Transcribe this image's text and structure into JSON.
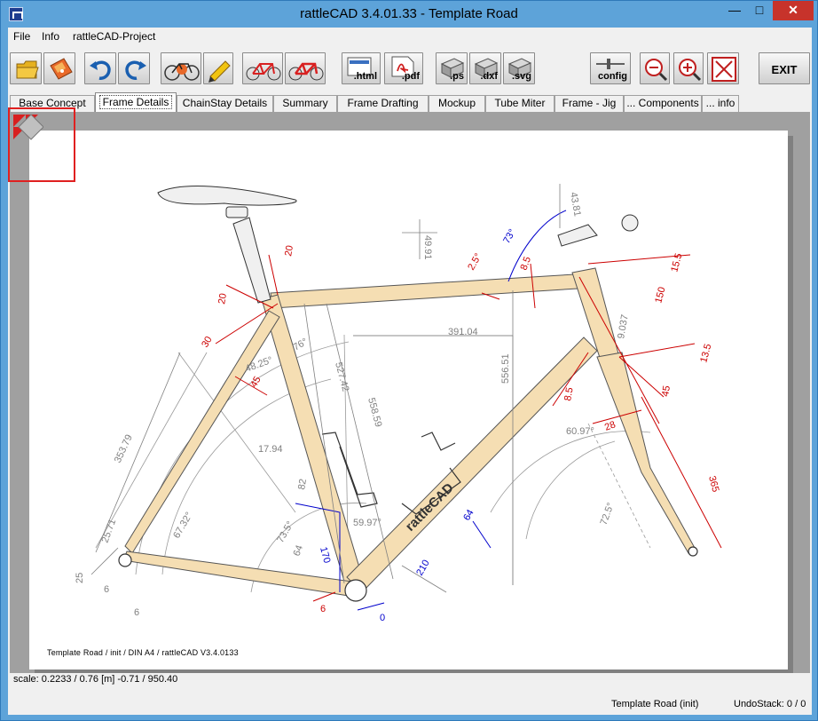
{
  "window": {
    "title": "rattleCAD  3.4.01.33 - Template Road",
    "minimize_glyph": "—",
    "maximize_glyph": "□",
    "close_glyph": "✕"
  },
  "menu": {
    "items": [
      "File",
      "Info",
      "rattleCAD-Project"
    ]
  },
  "toolbar": {
    "html_label": ".html",
    "pdf_label": ".pdf",
    "ps_label": ".ps",
    "dxf_label": ".dxf",
    "svg_label": ".svg",
    "config_label": "config",
    "exit_label": "EXIT"
  },
  "tabs": [
    "Base Concept",
    "Frame Details",
    "ChainStay Details",
    "Summary",
    "Frame Drafting",
    "Mockup",
    "Tube Miter",
    "Frame - Jig",
    "... Components",
    "... info"
  ],
  "active_tab": "Frame Details",
  "drawing": {
    "dims": {
      "d20a": "20",
      "d20b": "20",
      "d30": "30",
      "d45": "45",
      "d48": "48.25°",
      "d76": "76°",
      "d527": "527.42",
      "d558": "558.59",
      "d391": "391.04",
      "d556": "556.51",
      "d4991": "49.91",
      "d25": "2.5°",
      "d85a": "8.5",
      "d73": "73°",
      "d4381": "43.81",
      "d155": "15.5",
      "d150": "150",
      "d9037": "9.037",
      "d135": "13.5",
      "d45b": "45",
      "d85b": "8.5",
      "d28": "28",
      "d6097": "60.97°",
      "d365": "365",
      "d725": "72.5°",
      "d35379": "353.79",
      "d1794": "17.94",
      "d6732": "67.32°",
      "d2571": "25.71",
      "d25b": "25",
      "d6a": "6",
      "d6b": "6",
      "d735": "73.5°",
      "d64a": "64",
      "d170": "170",
      "d5997": "59.97°",
      "d64b": "64",
      "d210": "210",
      "d0": "0",
      "d6c": "6",
      "d82": "82"
    },
    "logo": "rattleCAD",
    "footer_note": "Template Road   /   init   / DIN A4 /   rattleCAD   V3.4.0133"
  },
  "status": {
    "scale": "scale: 0.2233 / 0.76  [m]  -0.71 / 950.40",
    "project": "Template Road (init)",
    "undo": "UndoStack:  0 / 0"
  },
  "colors": {
    "tube_fill": "#f5deb3",
    "dimension_red": "#cc0000",
    "dimension_blue": "#0000cc",
    "dimension_gray": "#808080",
    "titlebar": "#5da3d9",
    "close_button": "#c7332b"
  }
}
